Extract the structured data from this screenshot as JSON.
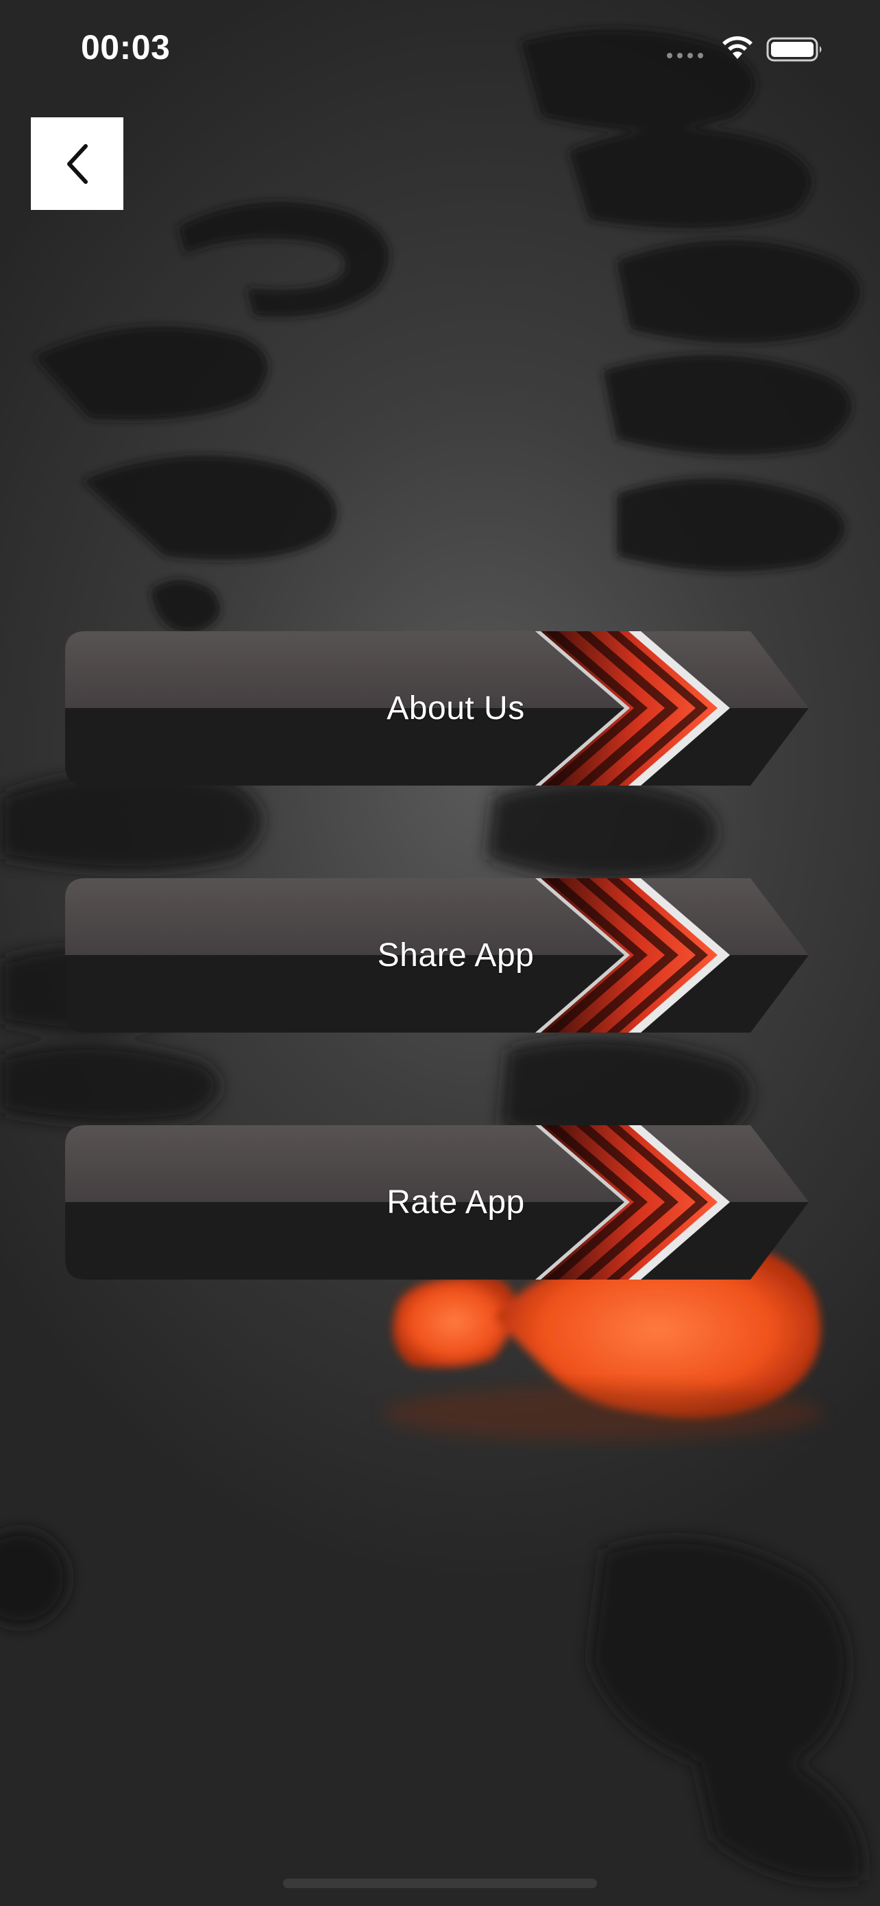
{
  "status_bar": {
    "time": "00:03",
    "signal_icon": "cellular-dots-icon",
    "wifi_icon": "wifi-icon",
    "battery_icon": "battery-icon"
  },
  "navigation": {
    "back_icon": "chevron-left-icon"
  },
  "menu": {
    "items": [
      {
        "label": "About Us"
      },
      {
        "label": "Share App"
      },
      {
        "label": "Rate App"
      }
    ]
  },
  "colors": {
    "button_top": "#4a4546",
    "button_bottom": "#1e1d1e",
    "chevron_accent": "#d9331f",
    "background": "#3d3d3d",
    "orange_accent": "#ff5a1f"
  }
}
